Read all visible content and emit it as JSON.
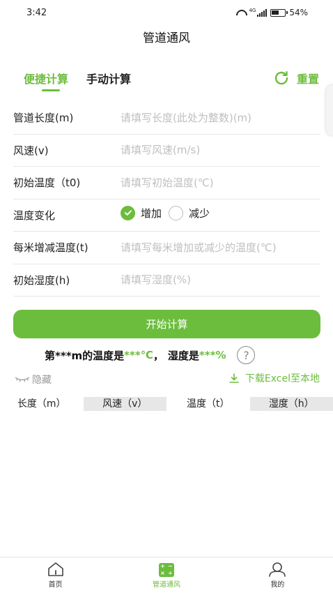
{
  "status_bar": {
    "time": "3:42",
    "network": "4G",
    "battery": "54%",
    "battery_level": 0.54
  },
  "header": {
    "title": "管道通风"
  },
  "tabs": [
    {
      "label": "便捷计算",
      "active": true
    },
    {
      "label": "手动计算",
      "active": false
    }
  ],
  "reset_label": "重置",
  "form": {
    "fields": [
      {
        "label": "管道长度(m)",
        "placeholder": "请填写长度(此处为整数)(m)"
      },
      {
        "label": "风速(v)",
        "placeholder": "请填写风速(m/s)"
      },
      {
        "label": "初始温度（t0)",
        "placeholder": "请填写初始温度(℃)"
      },
      {
        "label": "每米增减温度(t)",
        "placeholder": "请填写每米增加或减少的温度(℃)"
      },
      {
        "label": "初始湿度(h)",
        "placeholder": "请填写湿度(%)"
      }
    ],
    "temp_change": {
      "label": "温度变化",
      "options": [
        {
          "label": "增加",
          "checked": true
        },
        {
          "label": "减少",
          "checked": false
        }
      ]
    }
  },
  "start_button": "开始计算",
  "result": {
    "prefix": "第***m的温度是",
    "temp_value": "***℃",
    "sep": "，",
    "humidity_label": "湿度是",
    "humidity_value": "***%",
    "help_glyph": "?"
  },
  "hide_label": "隐藏",
  "download_label": "下载Excel至本地",
  "table": {
    "headers": [
      "长度（m）",
      "风速（v）",
      "温度（t）",
      "湿度（h）"
    ]
  },
  "bottom_nav": [
    {
      "label": "首页",
      "icon": "home-icon",
      "active": false
    },
    {
      "label": "管道通风",
      "icon": "calculator-icon",
      "active": true
    },
    {
      "label": "我的",
      "icon": "user-icon",
      "active": false
    }
  ],
  "colors": {
    "accent": "#6cbd3d",
    "placeholder": "#bfbfbf",
    "divider": "#e7e7e7"
  }
}
